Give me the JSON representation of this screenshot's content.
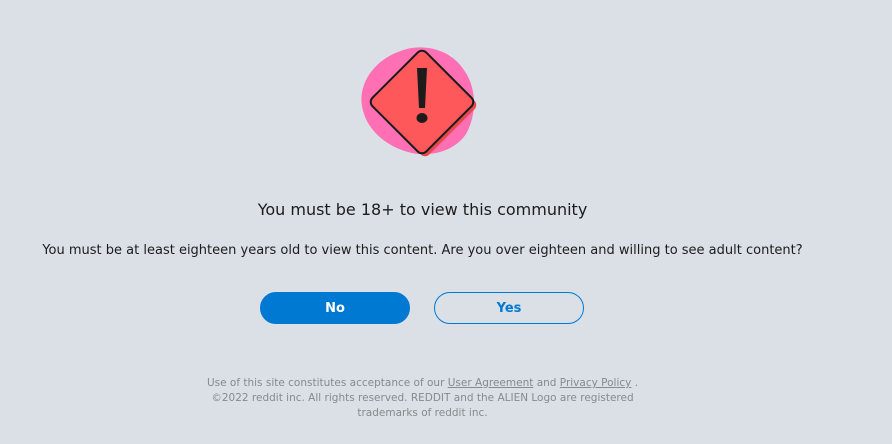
{
  "nsfw_gate": {
    "icon": "warning-sign-icon",
    "title": "You must be 18+ to view this community",
    "description": "You must be at least eighteen years old to view this content. Are you over eighteen and willing to see adult content?",
    "buttons": {
      "no_label": "No",
      "yes_label": "Yes"
    }
  },
  "footer": {
    "prefix": "Use of this site constitutes acceptance of our",
    "user_agreement": "User Agreement",
    "and": "and",
    "privacy_policy": "Privacy Policy",
    "period": ".",
    "line2": "©2022 reddit inc. All rights reserved. REDDIT and the ALIEN Logo are registered",
    "line3": "trademarks of reddit inc."
  },
  "colors": {
    "background": "#dae0e6",
    "accent": "#0079d3",
    "warning_fill": "#ff585b",
    "splash_pink": "#ff6fb3"
  }
}
